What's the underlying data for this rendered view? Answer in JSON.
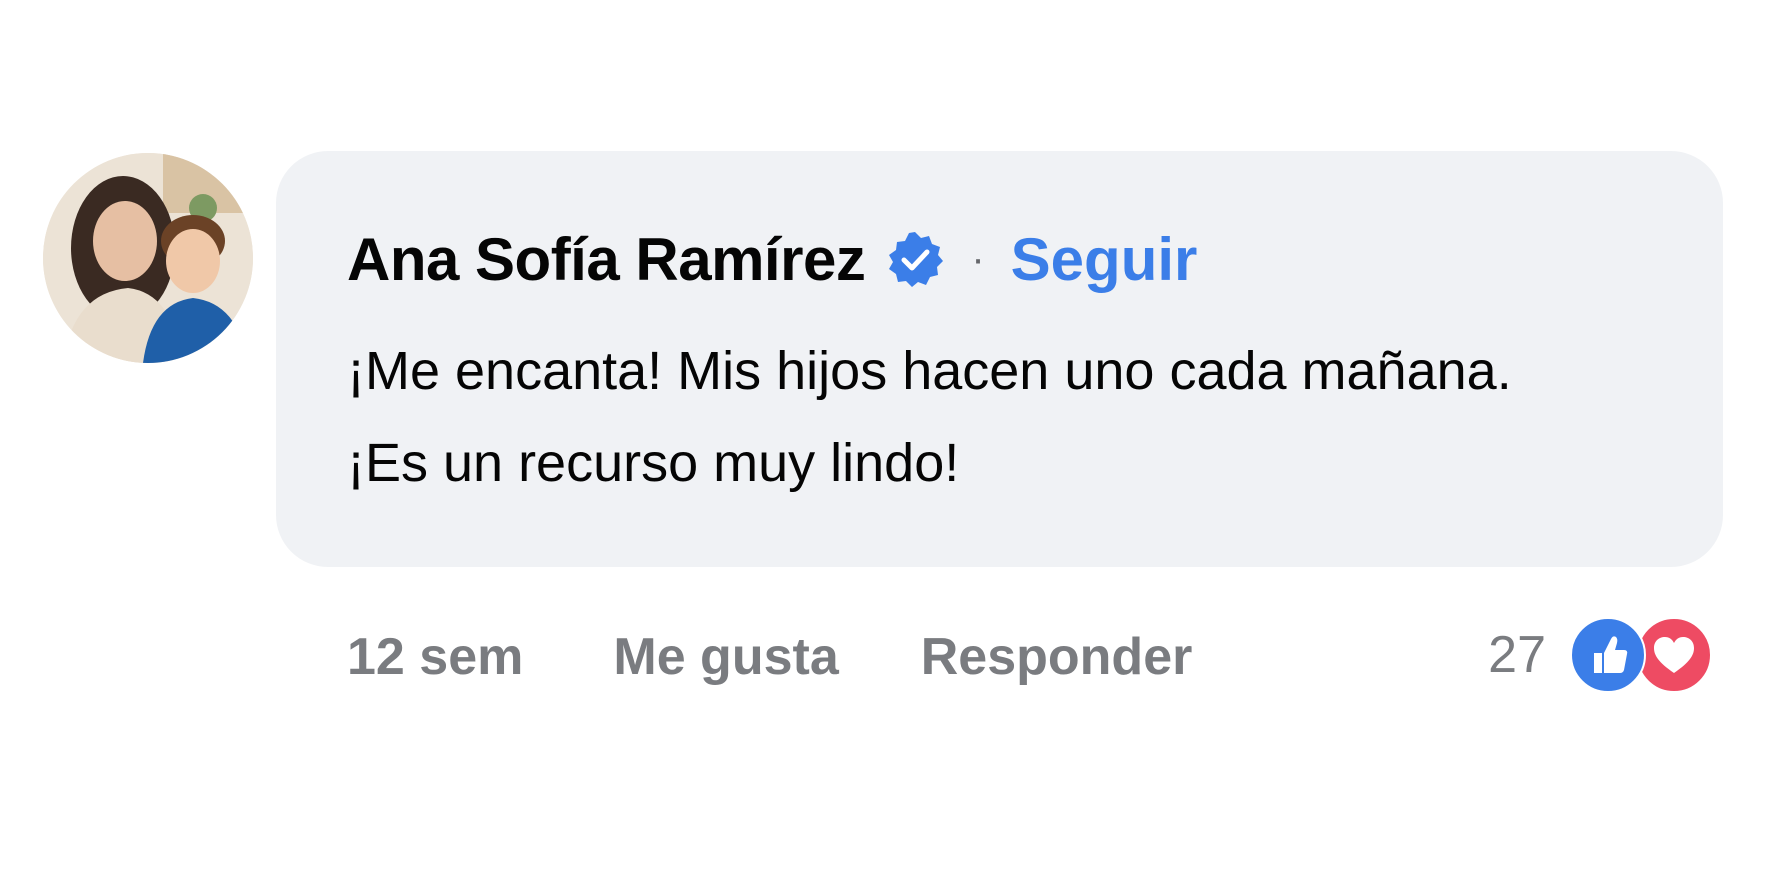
{
  "comment": {
    "author": "Ana Sofía Ramírez",
    "verified_icon": "verified-badge-icon",
    "separator": "·",
    "follow_label": "Seguir",
    "text_line1": "¡Me encanta! Mis hijos hacen uno cada mañana.",
    "text_line2": "¡Es un recurso muy lindo!",
    "avatar_icon": "user-avatar-photo"
  },
  "actions": {
    "time": "12 sem",
    "like_label": "Me gusta",
    "reply_label": "Responder"
  },
  "reactions": {
    "count": "27",
    "icons": [
      "like-reaction-icon",
      "love-reaction-icon"
    ]
  },
  "colors": {
    "bubble": "#f0f2f5",
    "link_blue": "#3b7ee8",
    "muted": "#7a7c80",
    "love_red": "#ee4b63"
  }
}
